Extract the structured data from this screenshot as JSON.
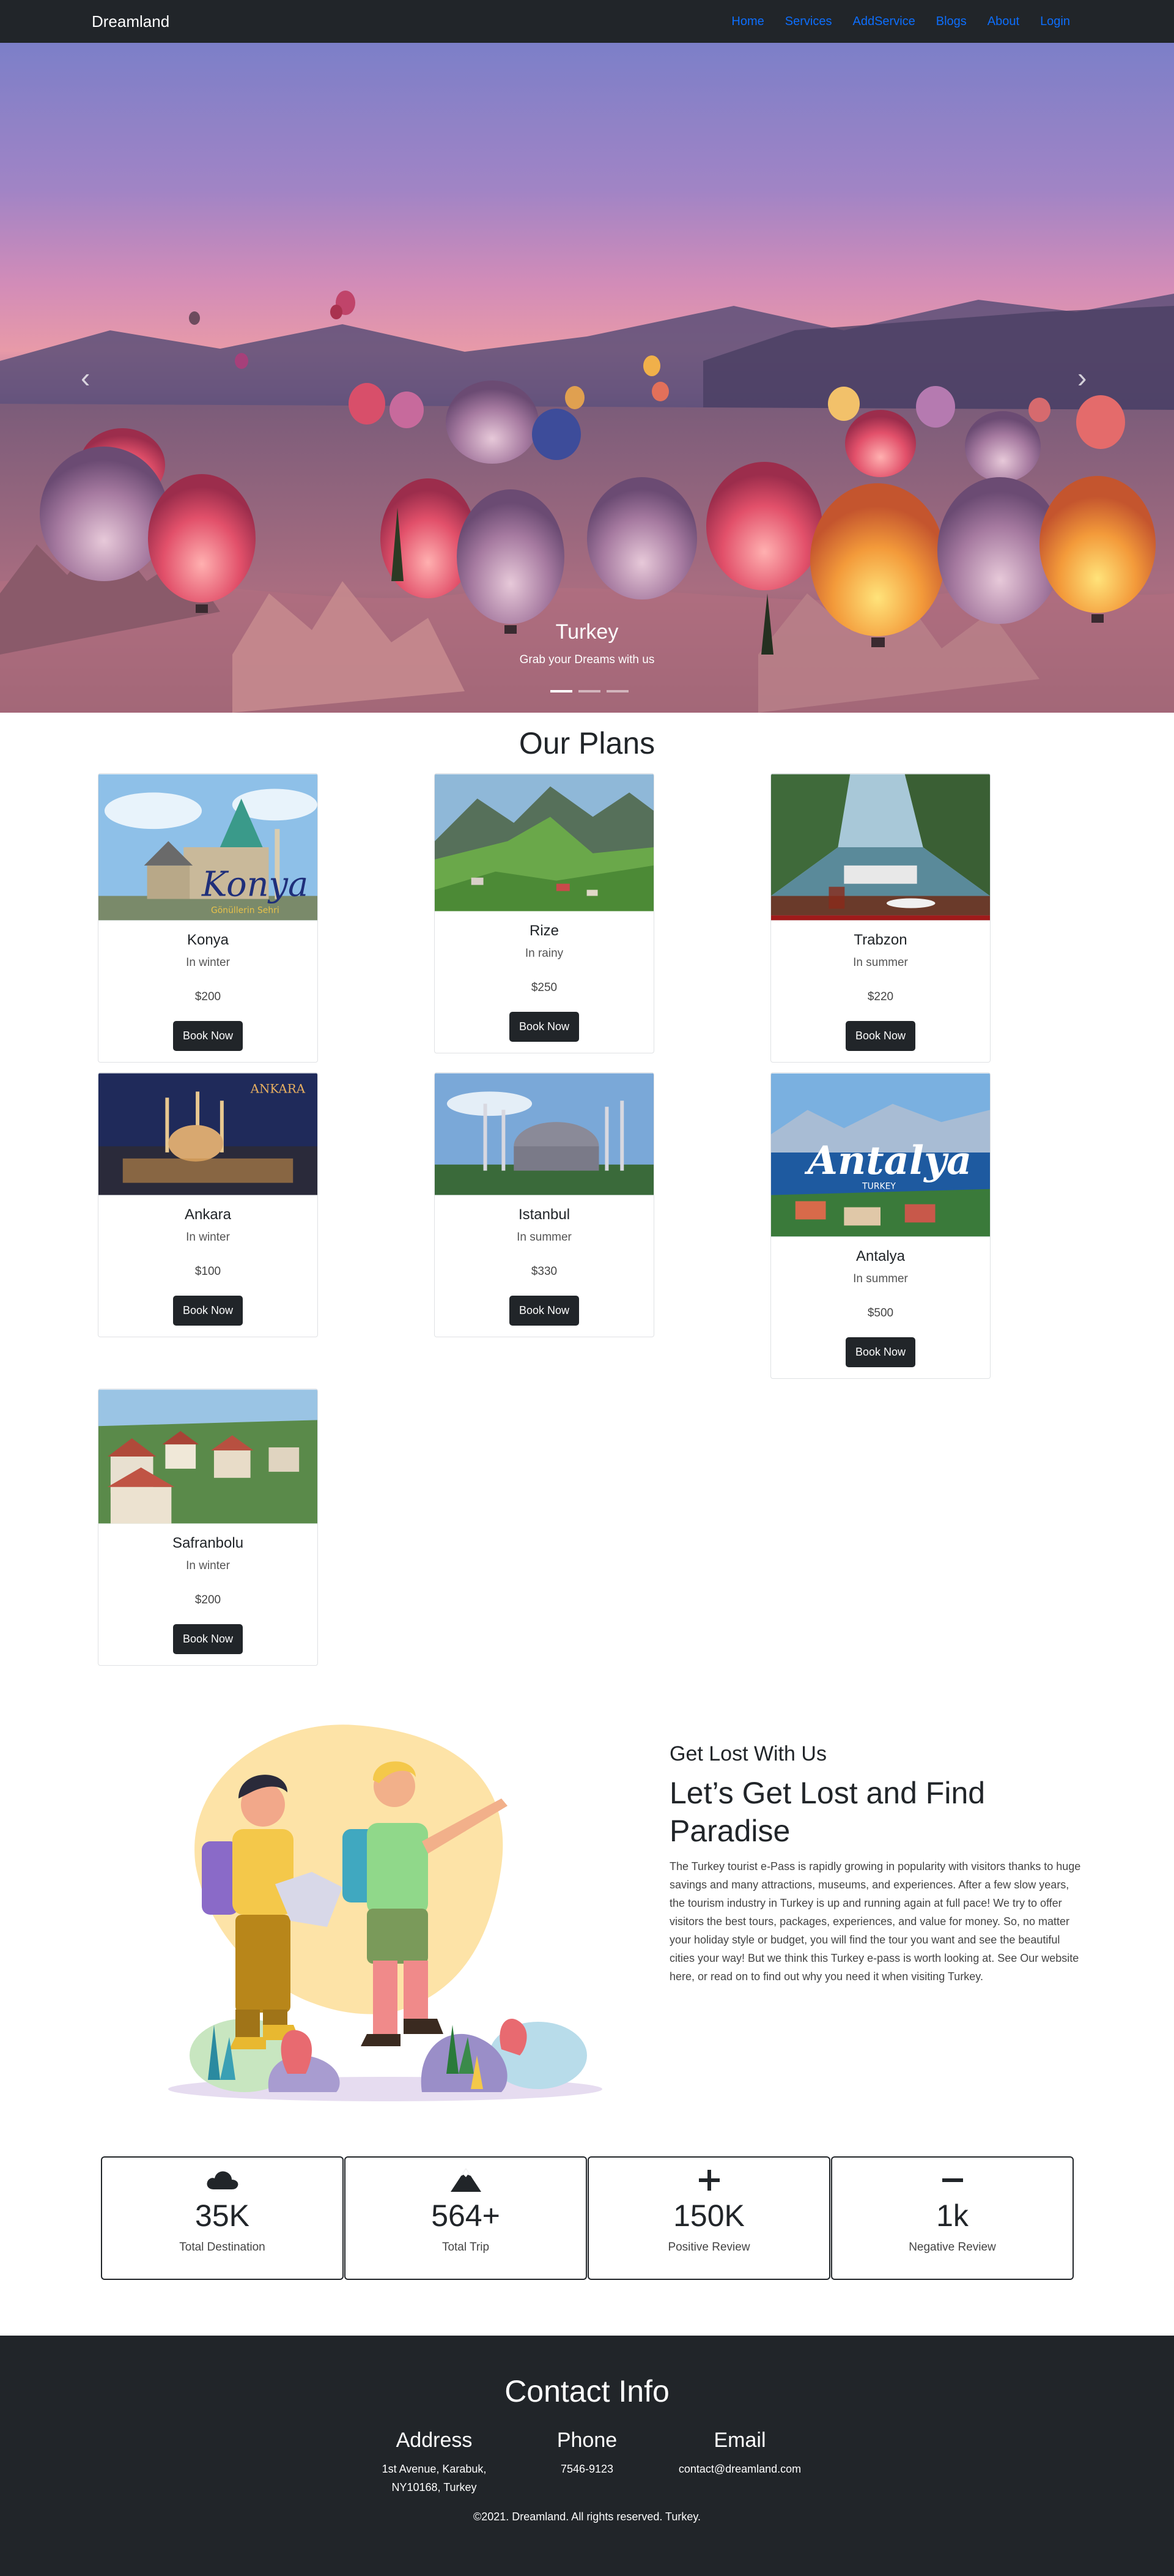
{
  "nav": {
    "brand": "Dreamland",
    "links": [
      "Home",
      "Services",
      "AddService",
      "Blogs",
      "About",
      "Login"
    ]
  },
  "hero": {
    "title": "Turkey",
    "subtitle": "Grab your Dreams with us",
    "prev_icon": "chevron-left-icon",
    "next_icon": "chevron-right-icon",
    "slides": 3,
    "active_slide": 1
  },
  "plans": {
    "title": "Our Plans",
    "button_label": "Book Now",
    "items": [
      {
        "name": "Konya",
        "season": "In winter",
        "price": "$200",
        "image_text": "Konya",
        "image_sub": "Gönüllerin Sehri"
      },
      {
        "name": "Rize",
        "season": "In rainy",
        "price": "$250"
      },
      {
        "name": "Trabzon",
        "season": "In summer",
        "price": "$220"
      },
      {
        "name": "Ankara",
        "season": "In winter",
        "price": "$100",
        "image_text": "ANKARA"
      },
      {
        "name": "Istanbul",
        "season": "In summer",
        "price": "$330"
      },
      {
        "name": "Antalya",
        "season": "In summer",
        "price": "$500",
        "image_text": "Antalya",
        "image_sub": "TURKEY"
      },
      {
        "name": "Safranbolu",
        "season": "In winter",
        "price": "$200"
      }
    ]
  },
  "about": {
    "kicker": "Get Lost With Us",
    "heading": "Let’s Get Lost and Find Paradise",
    "text": "The Turkey tourist e-Pass is rapidly growing in popularity with visitors thanks to huge savings and many attractions, museums, and experiences. After a few slow years, the tourism industry in Turkey is up and running again at full pace! We try to offer visitors the best tours, packages, experiences, and value for money. So, no matter your holiday style or budget, you will find the tour you want and see the beautiful cities your way! But we think this Turkey e-pass is worth looking at. See Our website here, or read on to find out why you need it when visiting Turkey."
  },
  "stats": [
    {
      "icon": "cloud-icon",
      "value": "35K",
      "label": "Total Destination"
    },
    {
      "icon": "mountain-icon",
      "value": "564+",
      "label": "Total Trip"
    },
    {
      "icon": "plus-icon",
      "value": "150K",
      "label": "Positive Review"
    },
    {
      "icon": "dash-icon",
      "value": "1k",
      "label": "Negative Review"
    }
  ],
  "contact": {
    "title": "Contact Info",
    "address_heading": "Address",
    "address_line1": "1st Avenue, Karabuk,",
    "address_line2": "NY10168, Turkey",
    "phone_heading": "Phone",
    "phone": "7546-9123",
    "email_heading": "Email",
    "email": "contact@dreamland.com",
    "copyright": "©2021. Dreamland. All rights reserved. Turkey."
  }
}
